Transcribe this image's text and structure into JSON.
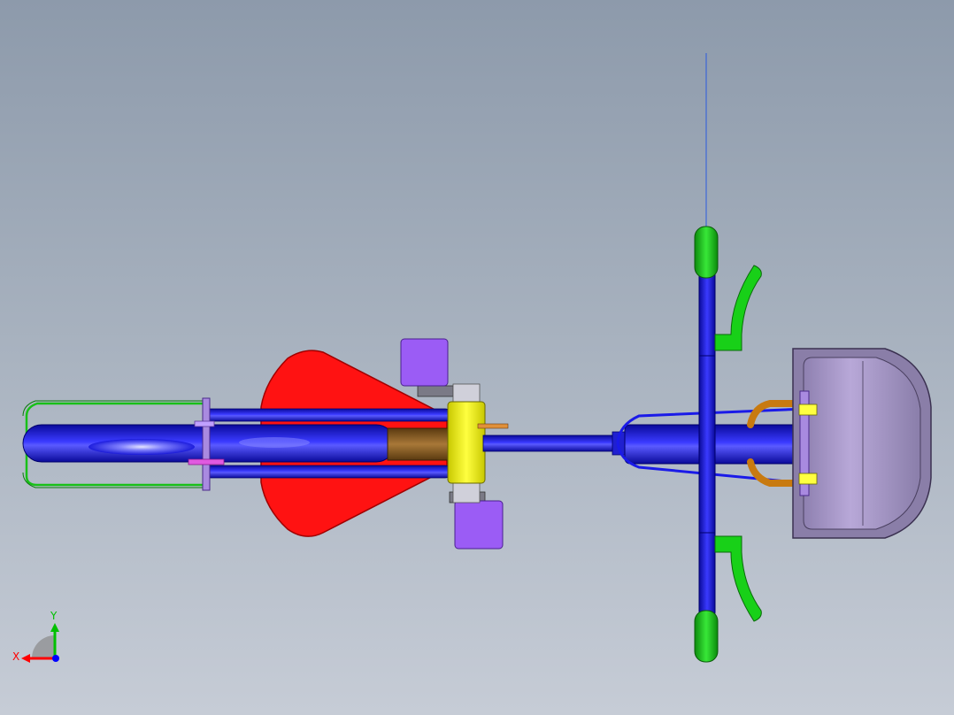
{
  "viewport": {
    "background_top": "#8d9aab",
    "background_bottom": "#c6ccd6"
  },
  "triad": {
    "x_label": "X",
    "y_label": "Y",
    "x_color": "#ff0000",
    "y_color": "#00c000",
    "z_color": "#0000ff"
  },
  "model": {
    "parts": [
      {
        "name": "seat",
        "color": "#ff1010"
      },
      {
        "name": "frame-tubes",
        "color": "#1010e8"
      },
      {
        "name": "handlebar",
        "color": "#1010e8"
      },
      {
        "name": "handlebar-grips",
        "color": "#1ecb1e"
      },
      {
        "name": "brake-levers",
        "color": "#1ecb1e"
      },
      {
        "name": "rear-fender-stays",
        "color": "#1ecb1e"
      },
      {
        "name": "pedals",
        "color": "#9b5cf5"
      },
      {
        "name": "crank-hub",
        "color": "#f5f500"
      },
      {
        "name": "basket",
        "color": "#a898c8"
      },
      {
        "name": "basket-brackets",
        "color": "#e08a10"
      },
      {
        "name": "chain-guard",
        "color": "#8a5a20"
      }
    ]
  }
}
